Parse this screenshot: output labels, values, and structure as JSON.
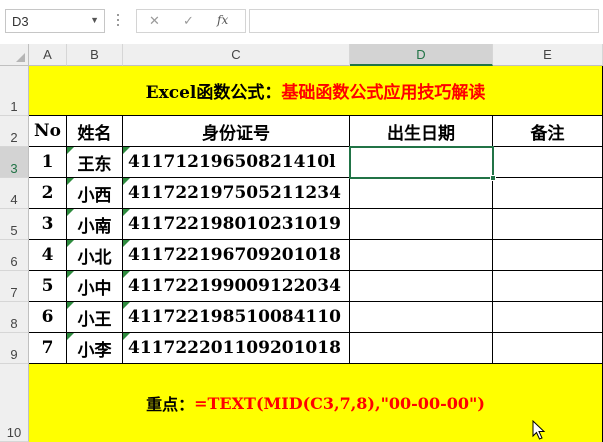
{
  "formula_bar": {
    "name_box": "D3",
    "cancel_glyph": "✕",
    "enter_glyph": "✓",
    "fx_label": "fx",
    "formula_value": ""
  },
  "columns": [
    "A",
    "B",
    "C",
    "D",
    "E"
  ],
  "rows": [
    "1",
    "2",
    "3",
    "4",
    "5",
    "6",
    "7",
    "8",
    "9",
    "10"
  ],
  "title": {
    "prefix": "Excel函数公式：",
    "main": "基础函数公式应用技巧解读"
  },
  "headers": {
    "no": "No",
    "name": "姓名",
    "id": "身份证号",
    "birth": "出生日期",
    "note": "备注"
  },
  "records": [
    {
      "no": "1",
      "name": "王东",
      "id": "41171219650821410l",
      "birth": "",
      "note": ""
    },
    {
      "no": "2",
      "name": "小西",
      "id": "411722197505211234",
      "birth": "",
      "note": ""
    },
    {
      "no": "3",
      "name": "小南",
      "id": "411722198010231019",
      "birth": "",
      "note": ""
    },
    {
      "no": "4",
      "name": "小北",
      "id": "411722196709201018",
      "birth": "",
      "note": ""
    },
    {
      "no": "5",
      "name": "小中",
      "id": "411722199009122034",
      "birth": "",
      "note": ""
    },
    {
      "no": "6",
      "name": "小王",
      "id": "411722198510084110",
      "birth": "",
      "note": ""
    },
    {
      "no": "7",
      "name": "小李",
      "id": "411722201109201018",
      "birth": "",
      "note": ""
    }
  ],
  "footer": {
    "label": "重点：",
    "formula": "=TEXT(MID(C3,7,8),\"00-00-00\")"
  },
  "colors": {
    "highlight": "#ffff00",
    "accent_red": "#ff0000",
    "selection": "#217346"
  }
}
